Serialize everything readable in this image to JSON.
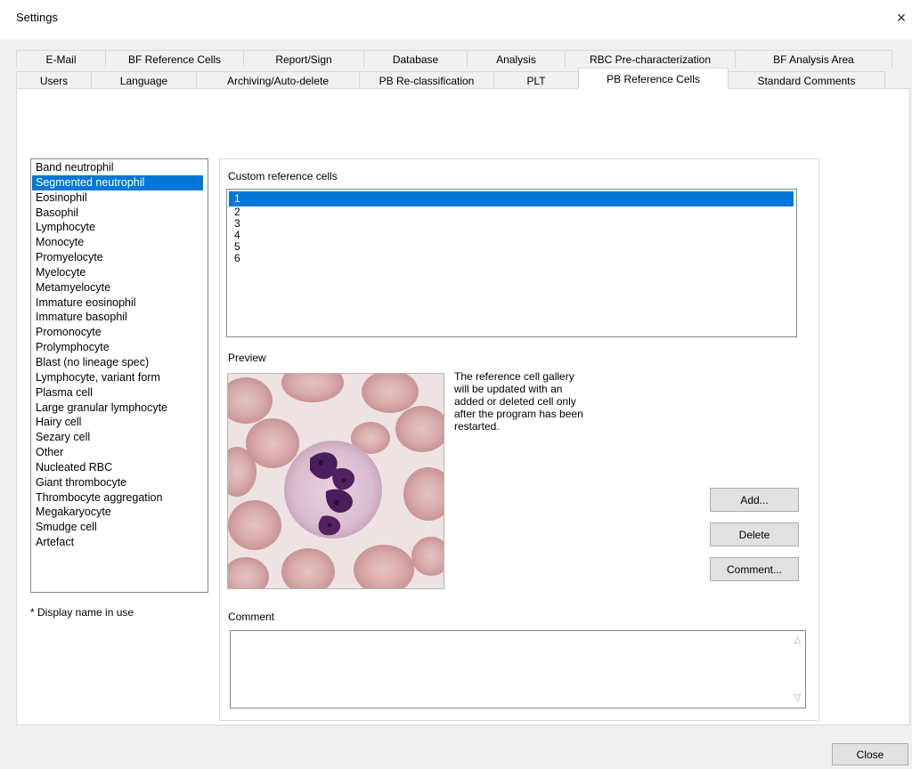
{
  "window": {
    "title": "Settings",
    "close_glyph": "×"
  },
  "tabs_row1": [
    {
      "label": "E-Mail",
      "w": 101
    },
    {
      "label": "BF Reference Cells",
      "w": 156
    },
    {
      "label": "Report/Sign",
      "w": 136
    },
    {
      "label": "Database",
      "w": 117
    },
    {
      "label": "Analysis",
      "w": 111
    },
    {
      "label": "RBC Pre-characterization",
      "w": 192
    },
    {
      "label": "BF Analysis Area",
      "w": 177
    }
  ],
  "tabs_row2": [
    {
      "label": "Users",
      "w": 85
    },
    {
      "label": "Language",
      "w": 119
    },
    {
      "label": "Archiving/Auto-delete",
      "w": 184
    },
    {
      "label": "PB Re-classification",
      "w": 152
    },
    {
      "label": "PLT",
      "w": 96
    },
    {
      "label": "PB Reference Cells",
      "w": 169,
      "active": true
    },
    {
      "label": "Standard Comments",
      "w": 177
    }
  ],
  "cell_types": [
    "Band neutrophil",
    "Segmented neutrophil",
    "Eosinophil",
    "Basophil",
    "Lymphocyte",
    "Monocyte",
    "Promyelocyte",
    "Myelocyte",
    "Metamyelocyte",
    "Immature eosinophil",
    "Immature basophil",
    "Promonocyte",
    "Prolymphocyte",
    "Blast (no lineage spec)",
    "Lymphocyte, variant form",
    "Plasma cell",
    "Large granular lymphocyte",
    "Hairy cell",
    "Sezary cell",
    "Other",
    "Nucleated RBC",
    "Giant thrombocyte",
    "Thrombocyte aggregation",
    "Megakaryocyte",
    "Smudge cell",
    "Artefact"
  ],
  "selected_cell_type": "Segmented neutrophil",
  "display_note": "* Display name in use",
  "custom_cells": {
    "label": "Custom reference cells",
    "items": [
      "1",
      "2",
      "3",
      "4",
      "5",
      "6"
    ],
    "selected": "1"
  },
  "preview": {
    "label": "Preview",
    "info": "The reference cell gallery will be updated with an added or deleted cell only after the program has been restarted."
  },
  "buttons": {
    "add": "Add...",
    "delete": "Delete",
    "comment": "Comment...",
    "close": "Close"
  },
  "comment": {
    "label": "Comment",
    "value": ""
  },
  "colors": {
    "selection": "#0078d7",
    "dialog_bg": "#f0f0f0"
  },
  "icons": {
    "close": "close-icon",
    "scroll_up": "chevron-up-icon",
    "scroll_down": "chevron-down-icon"
  }
}
